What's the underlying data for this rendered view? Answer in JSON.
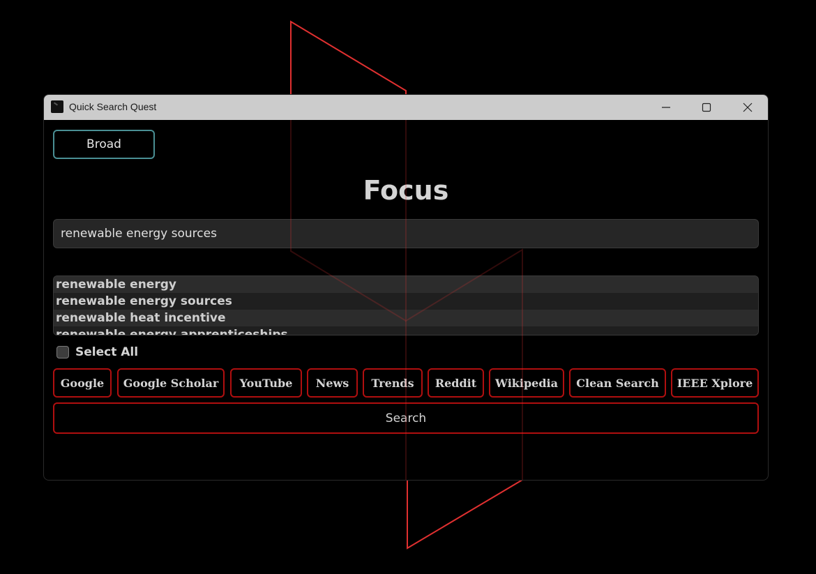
{
  "window": {
    "title": "Quick Search Quest",
    "minimize_icon": "minimize-icon",
    "maximize_icon": "maximize-icon",
    "close_icon": "close-icon"
  },
  "mode_button": {
    "label": "Broad"
  },
  "heading": "Focus",
  "search": {
    "value": "renewable energy sources",
    "placeholder": ""
  },
  "suggestions": [
    "renewable energy",
    "renewable energy sources",
    "renewable heat incentive",
    "renewable energy apprenticeships"
  ],
  "select_all": {
    "label": "Select All",
    "checked": false
  },
  "engines": [
    "Google",
    "Google Scholar",
    "YouTube",
    "News",
    "Trends",
    "Reddit",
    "Wikipedia",
    "Clean Search",
    "IEEE Xplore"
  ],
  "search_button": {
    "label": "Search"
  },
  "colors": {
    "background": "#000000",
    "titlebar": "#cccccc",
    "accent_teal": "#4a8f94",
    "accent_red": "#b00f0f",
    "decoration_red": "#e03030",
    "field_bg": "#262626",
    "text": "#d4d4d4"
  }
}
